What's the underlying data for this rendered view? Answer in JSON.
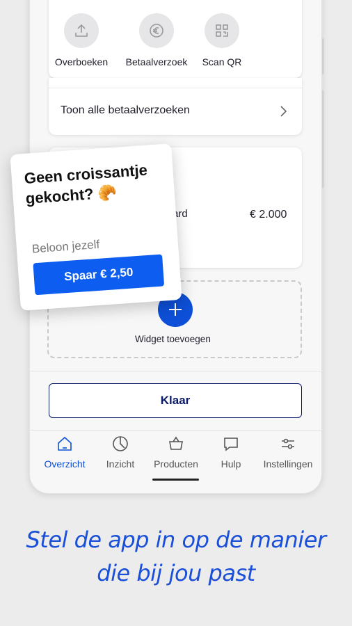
{
  "quick_actions": [
    {
      "label": "Overboeken",
      "icon": "upload-icon"
    },
    {
      "label": "Betaalverzoek",
      "icon": "euro-request-icon"
    },
    {
      "label": "Scan QR",
      "icon": "qr-code-icon"
    }
  ],
  "payment_requests": {
    "label": "Toon alle betaalverzoeken"
  },
  "savings_card": {
    "account_partial": "ard",
    "amount": "€ 2.000"
  },
  "add_widget": {
    "label": "Widget toevoegen"
  },
  "done_button": {
    "label": "Klaar"
  },
  "tabs": [
    {
      "label": "Overzicht",
      "icon": "home-icon",
      "active": true
    },
    {
      "label": "Inzicht",
      "icon": "pie-chart-icon",
      "active": false
    },
    {
      "label": "Producten",
      "icon": "basket-icon",
      "active": false
    },
    {
      "label": "Hulp",
      "icon": "chat-icon",
      "active": false
    },
    {
      "label": "Instellingen",
      "icon": "sliders-icon",
      "active": false
    }
  ],
  "promo": {
    "title": "Geen croissantje gekocht? 🥐",
    "subtitle": "Beloon jezelf",
    "cta_label": "Spaar € 2,50"
  },
  "caption": {
    "line1": "Stel de app in op de manier",
    "line2": "die bij jou past"
  },
  "colors": {
    "accent": "#0d4fd6",
    "button_navy": "#0a1a66",
    "caption_blue": "#1a4fd8",
    "background": "#ececec"
  }
}
